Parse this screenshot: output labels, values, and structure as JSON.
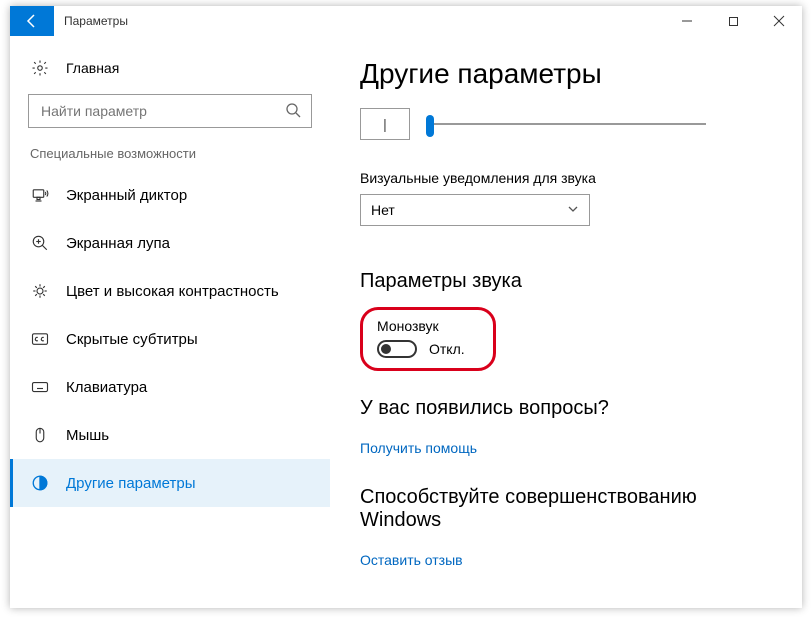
{
  "window": {
    "title": "Параметры"
  },
  "sidebar": {
    "home": "Главная",
    "search_placeholder": "Найти параметр",
    "category": "Специальные возможности",
    "items": [
      {
        "label": "Экранный диктор"
      },
      {
        "label": "Экранная лупа"
      },
      {
        "label": "Цвет и высокая контрастность"
      },
      {
        "label": "Скрытые субтитры"
      },
      {
        "label": "Клавиатура"
      },
      {
        "label": "Мышь"
      },
      {
        "label": "Другие параметры"
      }
    ]
  },
  "main": {
    "title": "Другие параметры",
    "slider_value": "|",
    "visual_notify_label": "Визуальные уведомления для звука",
    "visual_notify_value": "Нет",
    "sound_section": "Параметры звука",
    "mono_label": "Монозвук",
    "mono_state": "Откл.",
    "help_heading": "У вас появились вопросы?",
    "help_link": "Получить помощь",
    "feedback_heading": "Способствуйте совершенствованию Windows",
    "feedback_link": "Оставить отзыв"
  }
}
